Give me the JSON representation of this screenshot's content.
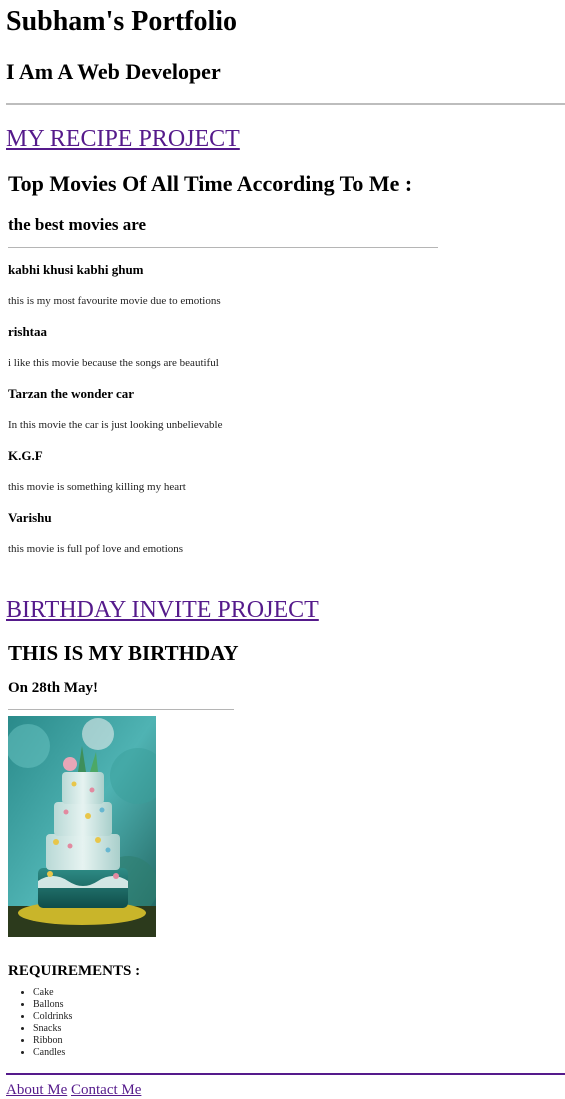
{
  "header": {
    "title": "Subham's Portfolio",
    "subtitle": "I Am A Web Developer"
  },
  "projects": {
    "recipe": {
      "link_label": "MY RECIPE PROJECT",
      "title": "Top Movies Of All Time According To Me :",
      "subtitle": "the best movies are",
      "movies": [
        {
          "name": "kabhi khusi kabhi ghum",
          "desc": "this is my most favourite movie due to emotions"
        },
        {
          "name": "rishtaa",
          "desc": "i like this movie because the songs are beautiful"
        },
        {
          "name": "Tarzan the wonder car",
          "desc": "In this movie the car is just looking unbelievable"
        },
        {
          "name": "K.G.F",
          "desc": "this movie is something killing my heart"
        },
        {
          "name": "Varishu",
          "desc": "this movie is full pof love and emotions"
        }
      ]
    },
    "birthday": {
      "link_label": "BIRTHDAY INVITE PROJECT",
      "title": "THIS IS MY BIRTHDAY",
      "date": "On 28th May!",
      "requirements_title": "REQUIREMENTS :",
      "requirements": [
        "Cake",
        "Ballons",
        "Coldrinks",
        "Snacks",
        "Ribbon",
        "Candles"
      ]
    }
  },
  "footer": {
    "about_label": "About Me",
    "contact_label": "Contact Me"
  },
  "colors": {
    "link": "#551a8b",
    "divider": "#bdbdbd"
  }
}
